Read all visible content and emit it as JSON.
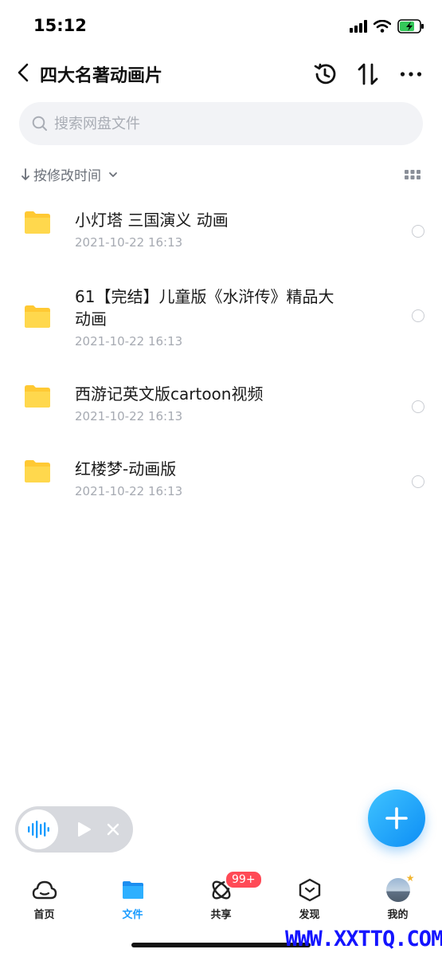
{
  "status_bar": {
    "time": "15:12"
  },
  "header": {
    "title": "四大名著动画片"
  },
  "search": {
    "placeholder": "搜索网盘文件"
  },
  "sort": {
    "label": "按修改时间"
  },
  "files": [
    {
      "name": "小灯塔 三国演义 动画",
      "date": "2021-10-22 16:13"
    },
    {
      "name": "61【完结】儿童版《水浒传》精品大动画",
      "date": "2021-10-22 16:13"
    },
    {
      "name": "西游记英文版cartoon视频",
      "date": "2021-10-22 16:13"
    },
    {
      "name": "红楼梦-动画版",
      "date": "2021-10-22 16:13"
    }
  ],
  "tabs": [
    {
      "label": "首页",
      "icon": "cloud-icon"
    },
    {
      "label": "文件",
      "icon": "folder-icon",
      "active": true
    },
    {
      "label": "共享",
      "icon": "share-orbit-icon",
      "badge": "99+"
    },
    {
      "label": "发现",
      "icon": "discover-cube-icon"
    },
    {
      "label": "我的",
      "icon": "avatar"
    }
  ],
  "watermark": "WWW.XXTTQ.COM",
  "colors": {
    "accent": "#1a9cff",
    "folder": "#ffcf3a",
    "badge": "#ff4a56",
    "watermark": "#1414ff"
  }
}
